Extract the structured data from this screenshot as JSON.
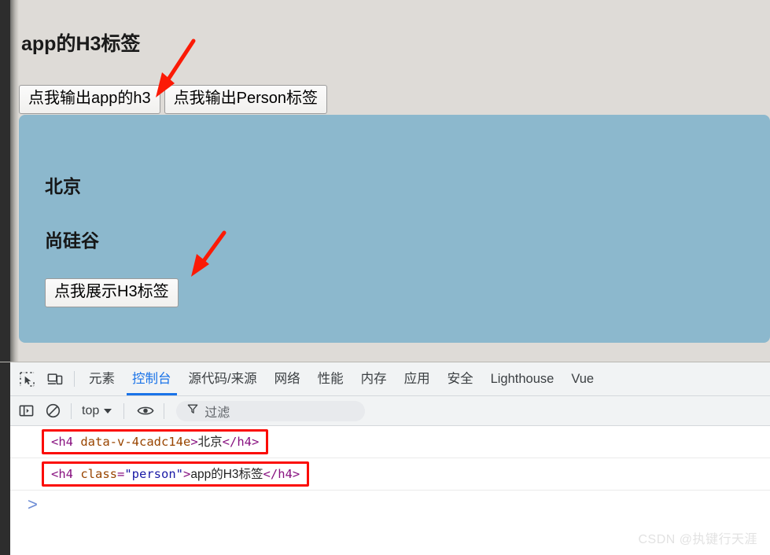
{
  "webpage": {
    "heading": "app的H3标签",
    "buttons": [
      {
        "label": "点我输出app的h3",
        "name": "output-app-h3-button"
      },
      {
        "label": "点我输出Person标签",
        "name": "output-person-button"
      }
    ],
    "panel": {
      "city": "北京",
      "school": "尚硅谷",
      "button_label": "点我展示H3标签",
      "background_color": "#8cb8cd"
    },
    "background_color": "#dedbd7"
  },
  "devtools": {
    "toolbar_icons": [
      {
        "name": "inspect-element-icon",
        "title": "检查元素"
      },
      {
        "name": "device-toolbar-icon",
        "title": "设备工具栏"
      }
    ],
    "tabs": [
      {
        "label": "元素",
        "active": false
      },
      {
        "label": "控制台",
        "active": true
      },
      {
        "label": "源代码/来源",
        "active": false
      },
      {
        "label": "网络",
        "active": false
      },
      {
        "label": "性能",
        "active": false
      },
      {
        "label": "内存",
        "active": false
      },
      {
        "label": "应用",
        "active": false
      },
      {
        "label": "安全",
        "active": false
      },
      {
        "label": "Lighthouse",
        "active": false
      },
      {
        "label": "Vue",
        "active": false
      }
    ],
    "active_tab": "控制台",
    "accent_color": "#1a73e8",
    "filterbar": {
      "sidebar_icon": "console-sidebar-icon",
      "clear_icon": "clear-console-icon",
      "context": "top",
      "eye_icon": "live-expression-icon",
      "filter_icon": "filter-funnel-icon",
      "filter_placeholder": "过滤",
      "filter_value": ""
    },
    "console_logs": [
      {
        "open": "<h4 ",
        "attr": "data-v-4cadc14e",
        "eq": "",
        "value": "",
        "close_bracket": ">",
        "text": "北京",
        "closing": "</h4>",
        "highlight_color": "#fb0c06"
      },
      {
        "open": "<h4 ",
        "attr": "class",
        "eq": "=",
        "value": "\"person\"",
        "close_bracket": ">",
        "text": "app的H3标签",
        "closing": "</h4>",
        "highlight_color": "#fb0c06"
      }
    ],
    "prompt": ">"
  },
  "watermark": "CSDN @执键行天涯"
}
